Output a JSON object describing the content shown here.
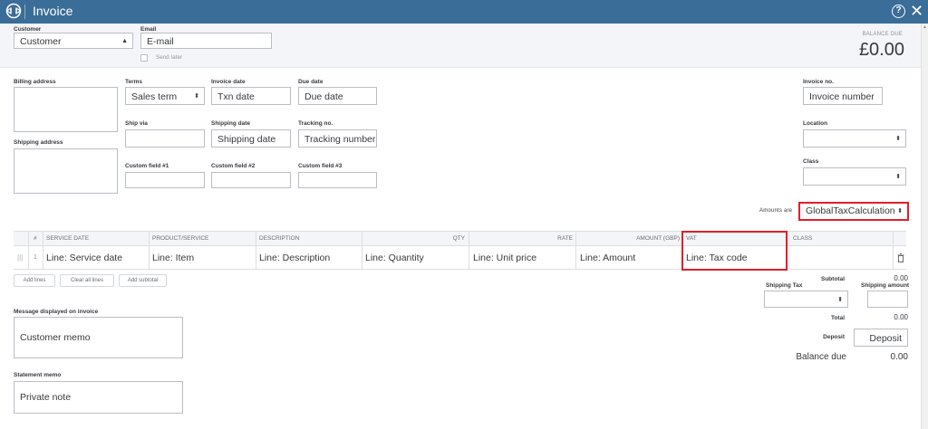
{
  "window": {
    "title": "Invoice",
    "logo_icon": "quickbooks-logo-icon",
    "help_label": "?",
    "close_label": "✕"
  },
  "header": {
    "customer": {
      "label": "Customer",
      "value": "Customer"
    },
    "email": {
      "label": "Email",
      "value": "E-mail"
    },
    "send_later": {
      "label": "Send later",
      "checked": false
    },
    "balance_due": {
      "label": "BALANCE DUE",
      "value": "£0.00"
    }
  },
  "form": {
    "billing_address": {
      "label": "Billing address",
      "value": ""
    },
    "shipping_address": {
      "label": "Shipping address",
      "value": ""
    },
    "terms": {
      "label": "Terms",
      "value": "Sales term"
    },
    "invoice_date": {
      "label": "Invoice date",
      "value": "Txn date"
    },
    "due_date": {
      "label": "Due date",
      "value": "Due date"
    },
    "ship_via": {
      "label": "Ship via",
      "value": ""
    },
    "shipping_date": {
      "label": "Shipping date",
      "value": "Shipping date"
    },
    "tracking_no": {
      "label": "Tracking no.",
      "value": "Tracking number"
    },
    "custom_field_1": {
      "label": "Custom field #1",
      "value": ""
    },
    "custom_field_2": {
      "label": "Custom field #2",
      "value": ""
    },
    "custom_field_3": {
      "label": "Custom field #3",
      "value": ""
    },
    "invoice_no": {
      "label": "Invoice no.",
      "value": "Invoice number"
    },
    "location": {
      "label": "Location",
      "value": ""
    },
    "class": {
      "label": "Class",
      "value": ""
    },
    "amounts_are": {
      "label": "Amounts are",
      "value": "GlobalTaxCalculation"
    }
  },
  "table": {
    "columns": {
      "num": "#",
      "service_date": "SERVICE DATE",
      "product": "PRODUCT/SERVICE",
      "description": "DESCRIPTION",
      "qty": "QTY",
      "rate": "RATE",
      "amount": "AMOUNT (GBP)",
      "vat": "VAT",
      "class": "CLASS"
    },
    "rows": [
      {
        "num": "1",
        "service_date": "Line: Service date",
        "product": "Line: Item",
        "description": "Line: Description",
        "qty": "Line: Quantity",
        "rate": "Line: Unit price",
        "amount": "Line: Amount",
        "vat": "Line: Tax code",
        "class": ""
      }
    ],
    "buttons": {
      "add_lines": "Add lines",
      "clear_all_lines": "Clear all lines",
      "add_subtotal": "Add subtotal"
    }
  },
  "totals": {
    "subtotal": {
      "label": "Subtotal",
      "value": "0.00"
    },
    "shipping_tax": {
      "label": "Shipping Tax",
      "value": ""
    },
    "shipping_amount": {
      "label": "Shipping amount",
      "value": ""
    },
    "total": {
      "label": "Total",
      "value": "0.00"
    },
    "deposit": {
      "label": "Deposit",
      "value": "Deposit"
    },
    "balance_due": {
      "label": "Balance due",
      "value": "0.00"
    }
  },
  "memos": {
    "message": {
      "label": "Message displayed on invoice",
      "value": "Customer memo"
    },
    "statement": {
      "label": "Statement memo",
      "value": "Private note"
    }
  },
  "colors": {
    "titlebar": "#3a6d97",
    "highlight": "#e01e2b"
  }
}
